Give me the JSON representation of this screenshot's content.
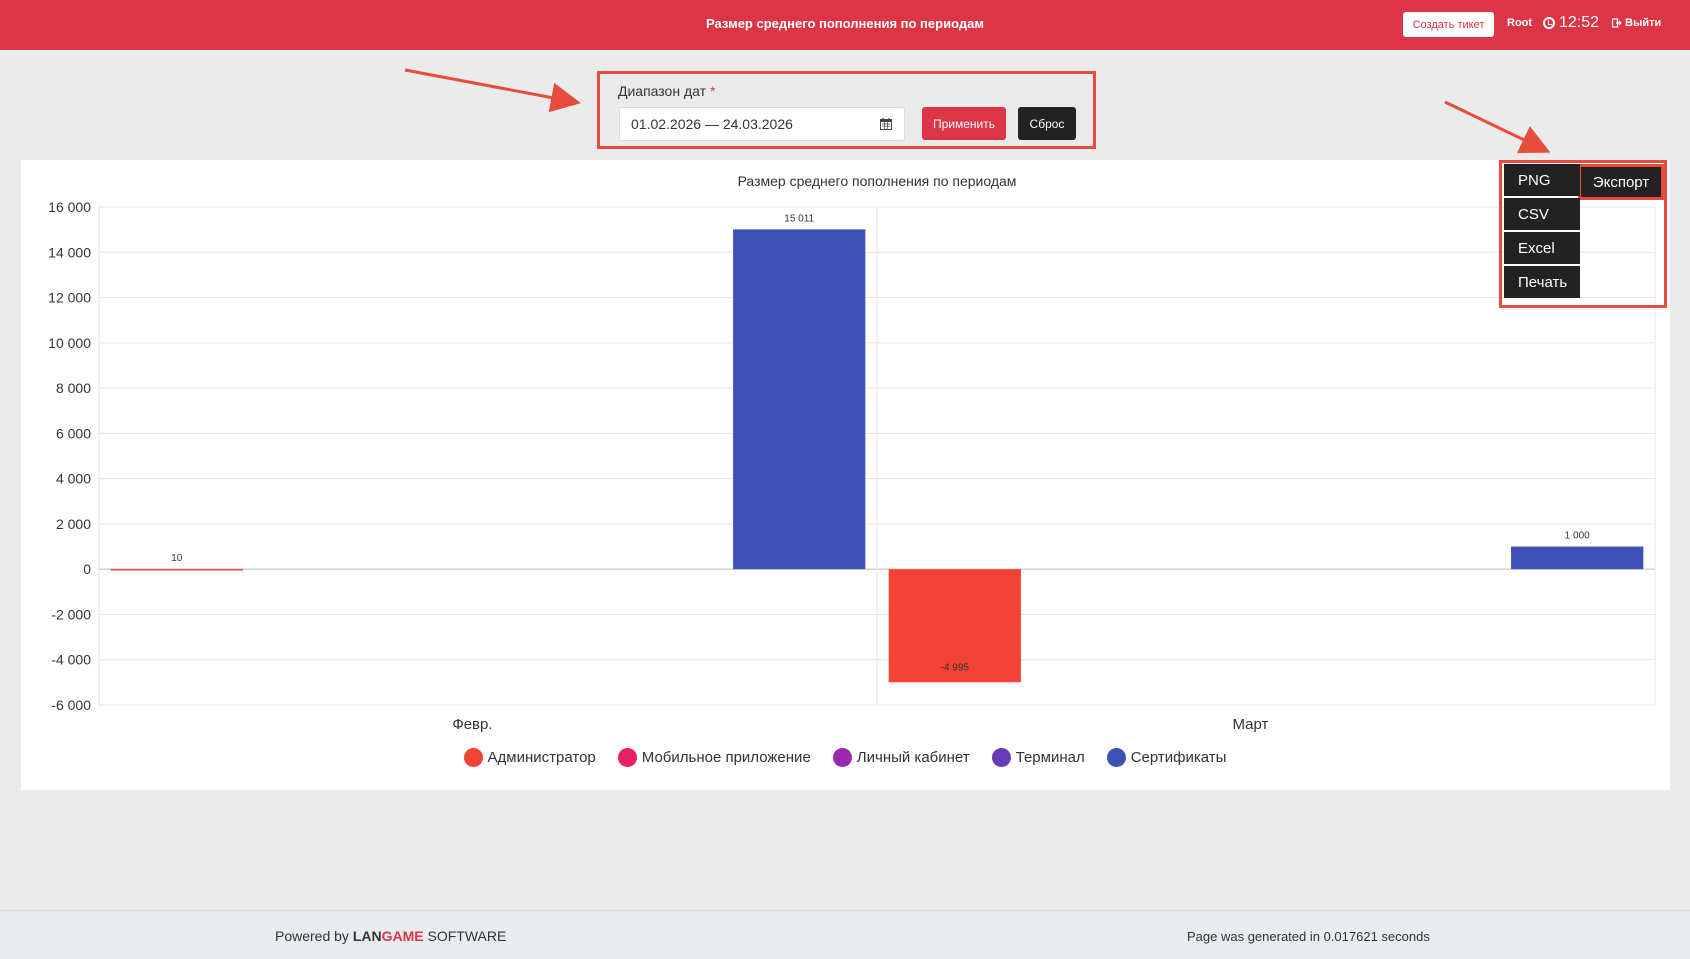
{
  "header": {
    "title": "Размер среднего пополнения по периодам",
    "create_ticket_label": "Создать тикет",
    "user_label": "Root",
    "time": "12:52",
    "logout_label": "Выйти"
  },
  "filter": {
    "label": "Диапазон дат",
    "required_mark": "*",
    "date_value": "01.02.2026 — 24.03.2026",
    "apply_label": "Применить",
    "reset_label": "Сброс"
  },
  "export": {
    "button_label": "Экспорт",
    "items": [
      "PNG",
      "CSV",
      "Excel",
      "Печать"
    ]
  },
  "colors": {
    "accent": "#dc3545",
    "annotation": "#e74c3c",
    "dark_button": "#222222"
  },
  "chart_data": {
    "type": "bar",
    "title": "Размер среднего пополнения по периодам",
    "categories": [
      "Февр.",
      "Март"
    ],
    "ylim": [
      -6000,
      16000
    ],
    "yticks": [
      16000,
      14000,
      12000,
      10000,
      8000,
      6000,
      4000,
      2000,
      0,
      -2000,
      -4000,
      -6000
    ],
    "ytick_labels": [
      "16 000",
      "14 000",
      "12 000",
      "10 000",
      "8 000",
      "6 000",
      "4 000",
      "2 000",
      "0",
      "-2 000",
      "-4 000",
      "-6 000"
    ],
    "grid": true,
    "legend_position": "bottom",
    "series": [
      {
        "name": "Администратор",
        "color": "#f44336",
        "values": [
          10,
          -4995
        ],
        "labels": [
          "10",
          "-4 995"
        ]
      },
      {
        "name": "Мобильное приложение",
        "color": "#e91e63",
        "values": [
          0,
          0
        ],
        "labels": [
          "",
          ""
        ]
      },
      {
        "name": "Личный кабинет",
        "color": "#9c27b0",
        "values": [
          0,
          0
        ],
        "labels": [
          "",
          ""
        ]
      },
      {
        "name": "Терминал",
        "color": "#673ab7",
        "values": [
          0,
          0
        ],
        "labels": [
          "",
          ""
        ]
      },
      {
        "name": "Сертификаты",
        "color": "#3f51b5",
        "values": [
          15011,
          1000
        ],
        "labels": [
          "15 011",
          "1 000"
        ]
      }
    ]
  },
  "footer": {
    "powered_prefix": "Powered by",
    "brand_lan": "LAN",
    "brand_game": "GAME",
    "brand_software": "SOFTWARE",
    "generated": "Page was generated in 0.017621 seconds"
  }
}
